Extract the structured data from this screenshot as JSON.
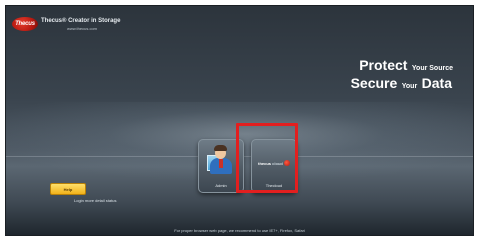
{
  "brand": {
    "logo_text": "Thecus",
    "tagline": "Thecus® Creator in Storage",
    "url": "www.thecus.com"
  },
  "slogan": {
    "line1_big": "Protect",
    "line1_small": "Your Source",
    "line2_big1": "Secure",
    "line2_small": "Your",
    "line2_big2": "Data"
  },
  "apps": [
    {
      "label": "Admin",
      "icon": "admin-person-icon"
    },
    {
      "label": "Thecloud",
      "logo_left": "thecus",
      "logo_right": "cloud",
      "icon": "thecloud-icon"
    }
  ],
  "help": {
    "button_label": "Help",
    "note": "Login more detail status"
  },
  "footer": {
    "text": "For proper browser web page, we recommend to use IE7+, Firefox, Safari"
  },
  "colors": {
    "highlight": "#e21f1f",
    "help_button": "#f2b21a",
    "logo_red": "#c9271a"
  }
}
